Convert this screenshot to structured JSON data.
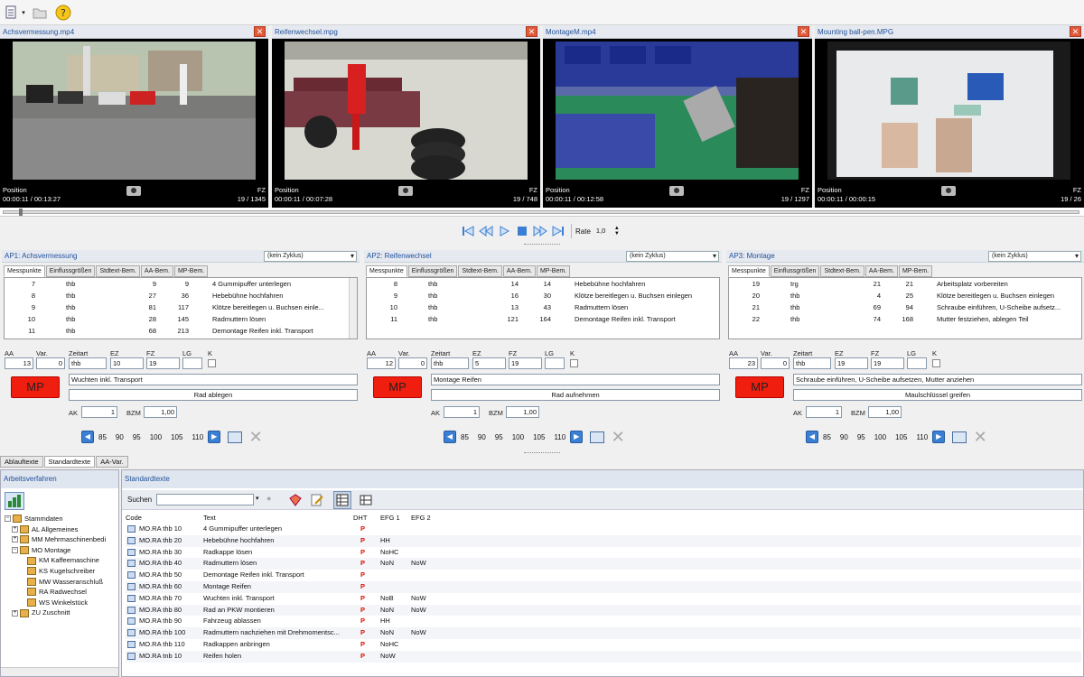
{
  "toolbar": {
    "icons": [
      "new-document-icon",
      "open-folder-icon",
      "help-icon"
    ]
  },
  "videos": [
    {
      "title": "Achsvermessung.mp4",
      "position_label": "Position",
      "time": "00:00:11 / 00:13:27",
      "fz_label": "FZ",
      "frames": "19 / 1345"
    },
    {
      "title": "Reifenwechsel.mpg",
      "position_label": "Position",
      "time": "00:00:11 / 00:07:28",
      "fz_label": "FZ",
      "frames": "19 / 748"
    },
    {
      "title": "MontageM.mp4",
      "position_label": "Position",
      "time": "00:00:11 / 00:12:58",
      "fz_label": "FZ",
      "frames": "19 / 1297"
    },
    {
      "title": "Mounting ball-pen.MPG",
      "position_label": "Position",
      "time": "00:00:11 / 00:00:15",
      "fz_label": "FZ",
      "frames": "19 / 26"
    }
  ],
  "playback": {
    "rate_label": "Rate",
    "rate_value": "1,0"
  },
  "panels": [
    {
      "title": "AP1: Achsvermessung",
      "zyklus": "(kein Zyklus)",
      "rows": [
        [
          "7",
          "thb",
          "9",
          "9",
          "4 Gummipuffer unterlegen"
        ],
        [
          "8",
          "thb",
          "27",
          "36",
          "Hebebühne hochfahren"
        ],
        [
          "9",
          "thb",
          "81",
          "117",
          "Klötze bereitlegen u. Buchsen einle..."
        ],
        [
          "10",
          "thb",
          "28",
          "145",
          "Radmuttern lösen"
        ],
        [
          "11",
          "thb",
          "68",
          "213",
          "Demontage Reifen inkl. Transport"
        ]
      ],
      "aa": "13",
      "var": "0",
      "zeitart": "thb",
      "ez": "10",
      "fz": "19",
      "lg": "",
      "text1": "Wuchten inkl. Transport",
      "text2": "Rad ablegen",
      "ak": "1",
      "bzm": "1,00"
    },
    {
      "title": "AP2: Reifenwechsel",
      "zyklus": "(kein Zyklus)",
      "rows": [
        [
          "8",
          "thb",
          "14",
          "14",
          "Hebebühne hochfahren"
        ],
        [
          "9",
          "thb",
          "16",
          "30",
          "Klötze bereitlegen u. Buchsen einlegen"
        ],
        [
          "10",
          "thb",
          "13",
          "43",
          "Radmuttern lösen"
        ],
        [
          "11",
          "thb",
          "121",
          "164",
          "Demontage Reifen inkl. Transport"
        ]
      ],
      "aa": "12",
      "var": "0",
      "zeitart": "thb",
      "ez": "5",
      "fz": "19",
      "lg": "",
      "text1": "Montage Reifen",
      "text2": "Rad aufnehmen",
      "ak": "1",
      "bzm": "1,00"
    },
    {
      "title": "AP3: Montage",
      "zyklus": "(kein Zyklus)",
      "rows": [
        [
          "19",
          "trg",
          "21",
          "21",
          "Arbeitsplatz vorbereiten"
        ],
        [
          "20",
          "thb",
          "4",
          "25",
          "Klötze bereitlegen u. Buchsen einlegen"
        ],
        [
          "21",
          "thb",
          "69",
          "94",
          "Schraube einführen, U-Scheibe aufsetz..."
        ],
        [
          "22",
          "thb",
          "74",
          "168",
          "Mutter festziehen, ablegen Teil"
        ]
      ],
      "aa": "23",
      "var": "0",
      "zeitart": "thb",
      "ez": "19",
      "fz": "19",
      "lg": "",
      "text1": "Schraube einführen, U-Scheibe aufsetzen, Mutter anziehen",
      "text2": "Maulschlüssel greifen",
      "ak": "1",
      "bzm": "1,00"
    }
  ],
  "panel_tabs": [
    "Messpunkte",
    "Einflussgrößen",
    "Stdtext-Bem.",
    "AA-Bem.",
    "MP-Bem."
  ],
  "field_labels": {
    "aa": "AA",
    "var": "Var.",
    "zeitart": "Zeitart",
    "ez": "EZ",
    "fz": "FZ",
    "lg": "LG",
    "k": "K",
    "ak": "AK",
    "bzm": "BZM",
    "mp": "MP"
  },
  "rates": [
    "85",
    "90",
    "95",
    "100",
    "105",
    "110"
  ],
  "bottom_tabs": [
    "Ablauftexte",
    "Standardtexte",
    "AA-Var."
  ],
  "left": {
    "title": "Arbeitsverfahren",
    "tree": [
      {
        "exp": "−",
        "label": "Stammdaten",
        "indent": 0
      },
      {
        "exp": "+",
        "label": "AL  Allgemeines",
        "indent": 1
      },
      {
        "exp": "+",
        "label": "MM  Mehrmaschinenbedi",
        "indent": 1
      },
      {
        "exp": "−",
        "label": "MO  Montage",
        "indent": 1
      },
      {
        "exp": "",
        "label": "KM  Kaffeemaschine",
        "indent": 2
      },
      {
        "exp": "",
        "label": "KS  Kugelschreiber",
        "indent": 2
      },
      {
        "exp": "",
        "label": "MW  Wasseranschluß",
        "indent": 2
      },
      {
        "exp": "",
        "label": "RA  Radwechsel",
        "indent": 2
      },
      {
        "exp": "",
        "label": "WS  Winkelstück",
        "indent": 2
      },
      {
        "exp": "+",
        "label": "ZU  Zuschnitt",
        "indent": 1
      }
    ]
  },
  "right": {
    "title": "Standardtexte",
    "search_label": "Suchen",
    "search_value": "",
    "headers": [
      "Code",
      "Text",
      "DHT",
      "EFG 1",
      "EFG 2"
    ],
    "rows": [
      [
        "MO.RA thb 10",
        "4 Gummipuffer unterlegen",
        "P",
        "",
        ""
      ],
      [
        "MO.RA thb 20",
        "Hebebühne hochfahren",
        "P",
        "HH",
        ""
      ],
      [
        "MO.RA thb 30",
        "Radkappe lösen",
        "P",
        "NoHC",
        ""
      ],
      [
        "MO.RA thb 40",
        "Radmuttern lösen",
        "P",
        "NoN",
        "NoW"
      ],
      [
        "MO.RA thb 50",
        "Demontage Reifen inkl. Transport",
        "P",
        "",
        ""
      ],
      [
        "MO.RA thb 60",
        "Montage Reifen",
        "P",
        "",
        ""
      ],
      [
        "MO.RA thb 70",
        "Wuchten inkl. Transport",
        "P",
        "NoB",
        "NoW"
      ],
      [
        "MO.RA thb 80",
        "Rad an PKW montieren",
        "P",
        "NoN",
        "NoW"
      ],
      [
        "MO.RA thb 90",
        "Fahrzeug ablassen",
        "P",
        "HH",
        ""
      ],
      [
        "MO.RA thb 100",
        "Radmuttern nachziehen mit Drehmomentsc...",
        "P",
        "NoN",
        "NoW"
      ],
      [
        "MO.RA thb 110",
        "Radkappen anbringen",
        "P",
        "NoHC",
        ""
      ],
      [
        "MO.RA tnb 10",
        "Reifen holen",
        "P",
        "NoW",
        ""
      ]
    ]
  }
}
